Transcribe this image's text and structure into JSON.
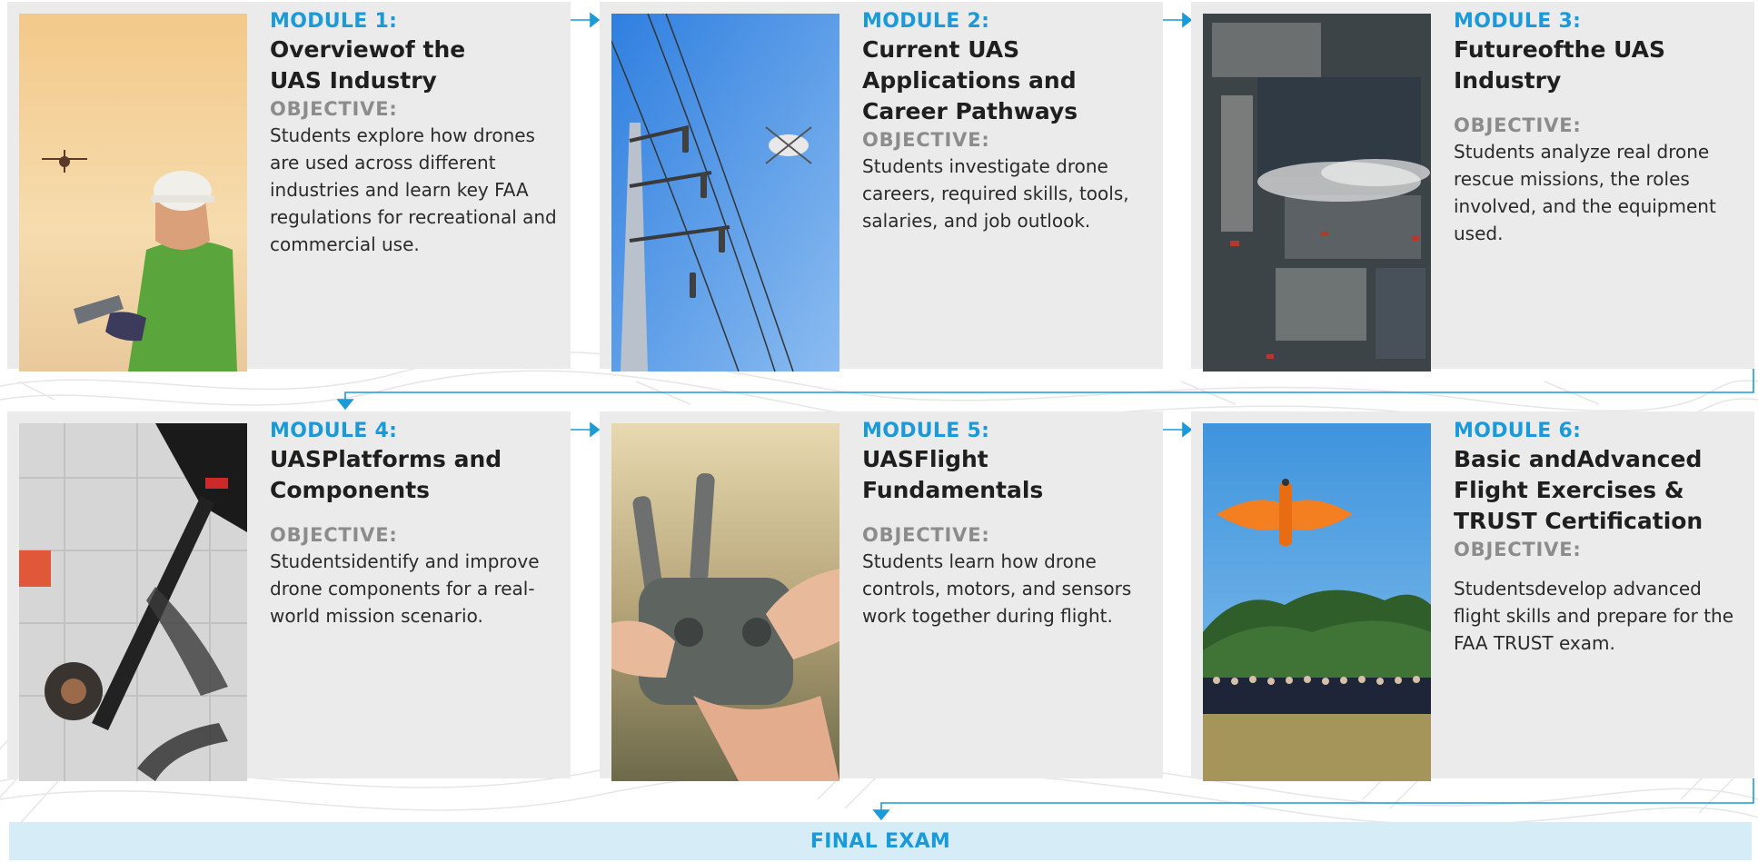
{
  "colors": {
    "accent": "#1a9ad9",
    "card_bg": "#ebebeb",
    "final_bg": "#d6ecf7"
  },
  "modules": [
    {
      "label": "MODULE 1:",
      "title_lines": [
        "Overviewof the",
        "UAS Industry"
      ],
      "objective_label": "OBJECTIVE:",
      "description": "Students explore how drones are used across different industries and learn key FAA regulations for recreational and commercial use.",
      "photo": "drone-pilot-photo"
    },
    {
      "label": "MODULE 2:",
      "title_lines": [
        "Current UAS",
        "Applications and",
        "Career Pathways"
      ],
      "objective_label": "OBJECTIVE:",
      "description": "Students investigate drone careers, required skills, tools, salaries, and job outlook.",
      "photo": "power-line-drone-photo"
    },
    {
      "label": "MODULE 3:",
      "title_lines": [
        "Futureofthe UAS",
        "Industry"
      ],
      "objective_label": "OBJECTIVE:",
      "description": "Students analyze real drone rescue missions, the roles involved, and the equipment used.",
      "photo": "aerial-fire-photo"
    },
    {
      "label": "MODULE 4:",
      "title_lines": [
        "UASPlatforms and",
        "Components"
      ],
      "objective_label": "OBJECTIVE:",
      "description": "Studentsidentify and improve drone components for a real-world mission scenario.",
      "photo": "drone-components-photo"
    },
    {
      "label": "MODULE 5:",
      "title_lines": [
        "UASFlight",
        "Fundamentals"
      ],
      "objective_label": "OBJECTIVE:",
      "description": "Students learn how drone controls, motors, and sensors work together during flight.",
      "photo": "remote-controller-photo"
    },
    {
      "label": "MODULE 6:",
      "title_lines": [
        "Basic andAdvanced",
        "Flight Exercises &",
        "TRUST Certification"
      ],
      "objective_label": "OBJECTIVE:",
      "description": "Studentsdevelop advanced flight skills and prepare for the FAA TRUST exam.",
      "photo": "fixed-wing-drone-photo"
    }
  ],
  "final": {
    "label": "FINAL EXAM"
  }
}
